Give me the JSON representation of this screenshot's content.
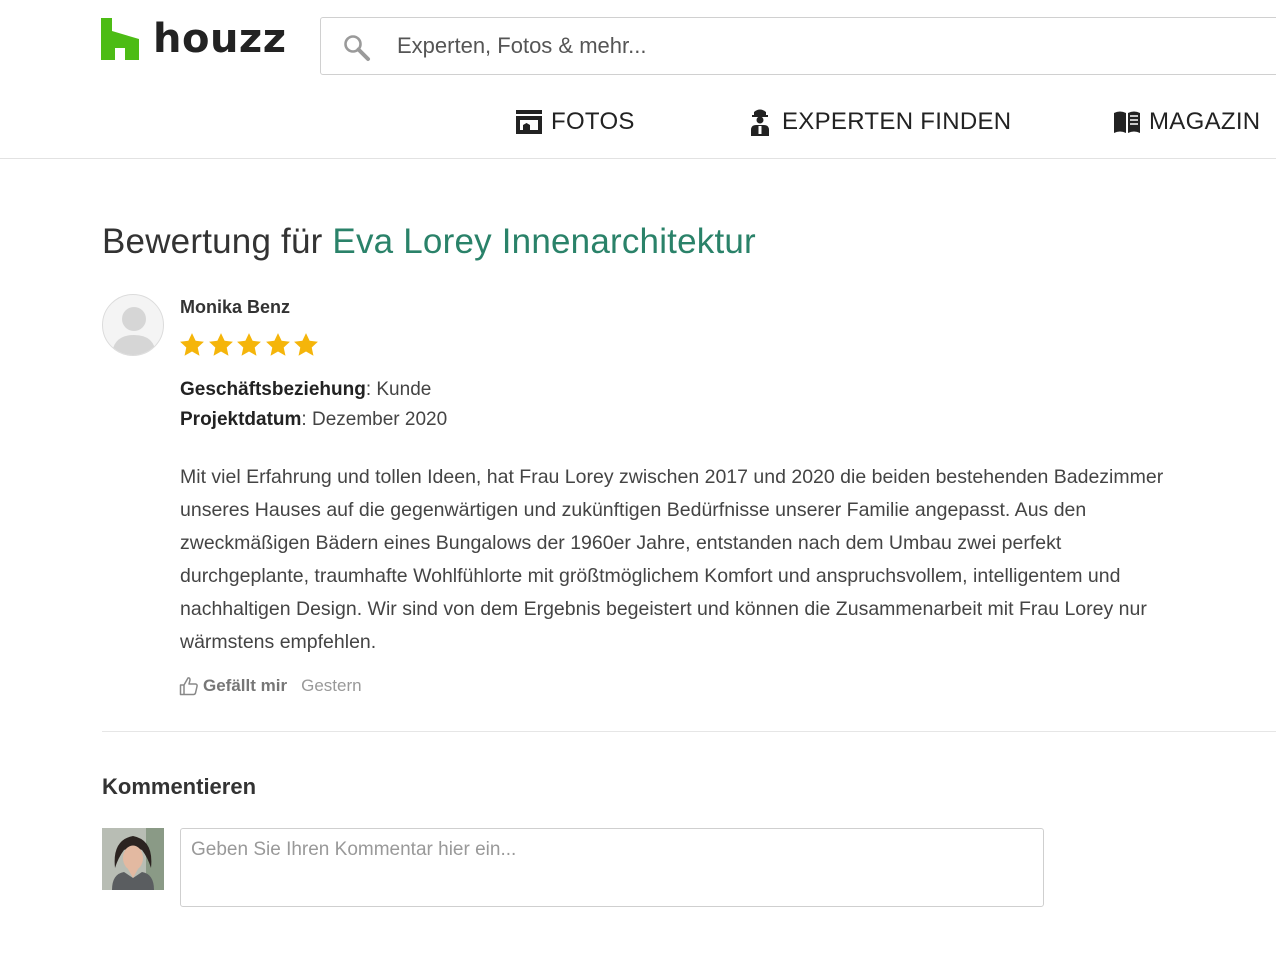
{
  "brand": {
    "name": "houzz",
    "color": "#4dbc15"
  },
  "search": {
    "placeholder": "Experten, Fotos & mehr..."
  },
  "nav": [
    {
      "label": "FOTOS",
      "icon": "photos-icon"
    },
    {
      "label": "EXPERTEN FINDEN",
      "icon": "professional-icon"
    },
    {
      "label": "MAGAZIN",
      "icon": "magazine-icon"
    }
  ],
  "review": {
    "title_prefix": "Bewertung für ",
    "business_name": "Eva Lorey Innenarchitektur",
    "reviewer": "Monika Benz",
    "rating": 5,
    "rating_max": 5,
    "relationship_label": "Geschäftsbeziehung",
    "relationship_value": ": Kunde",
    "project_date_label": "Projektdatum",
    "project_date_value": ": Dezember 2020",
    "text": "Mit viel Erfahrung und tollen Ideen, hat Frau Lorey zwischen 2017 und 2020 die beiden bestehenden Badezimmer unseres Hauses auf die gegenwärtigen und zukünftigen Bedürfnisse unserer Familie angepasst. Aus den zweckmäßigen Bädern eines Bungalows der 1960er Jahre, entstanden nach dem Umbau zwei perfekt durchgeplante, traumhafte Wohlfühlorte mit größtmöglichem Komfort und anspruchsvollem, intelligentem und nachhaltigen Design. Wir sind von dem Ergebnis begeistert und können die Zusammenarbeit mit Frau Lorey nur wärmstens empfehlen.",
    "like_label": "Gefällt mir",
    "timestamp": "Gestern"
  },
  "comment": {
    "heading": "Kommentieren",
    "placeholder": "Geben Sie Ihren Kommentar hier ein..."
  },
  "colors": {
    "accent": "#2a8269",
    "star": "#f5b50a",
    "brand_green": "#4dbc15"
  }
}
